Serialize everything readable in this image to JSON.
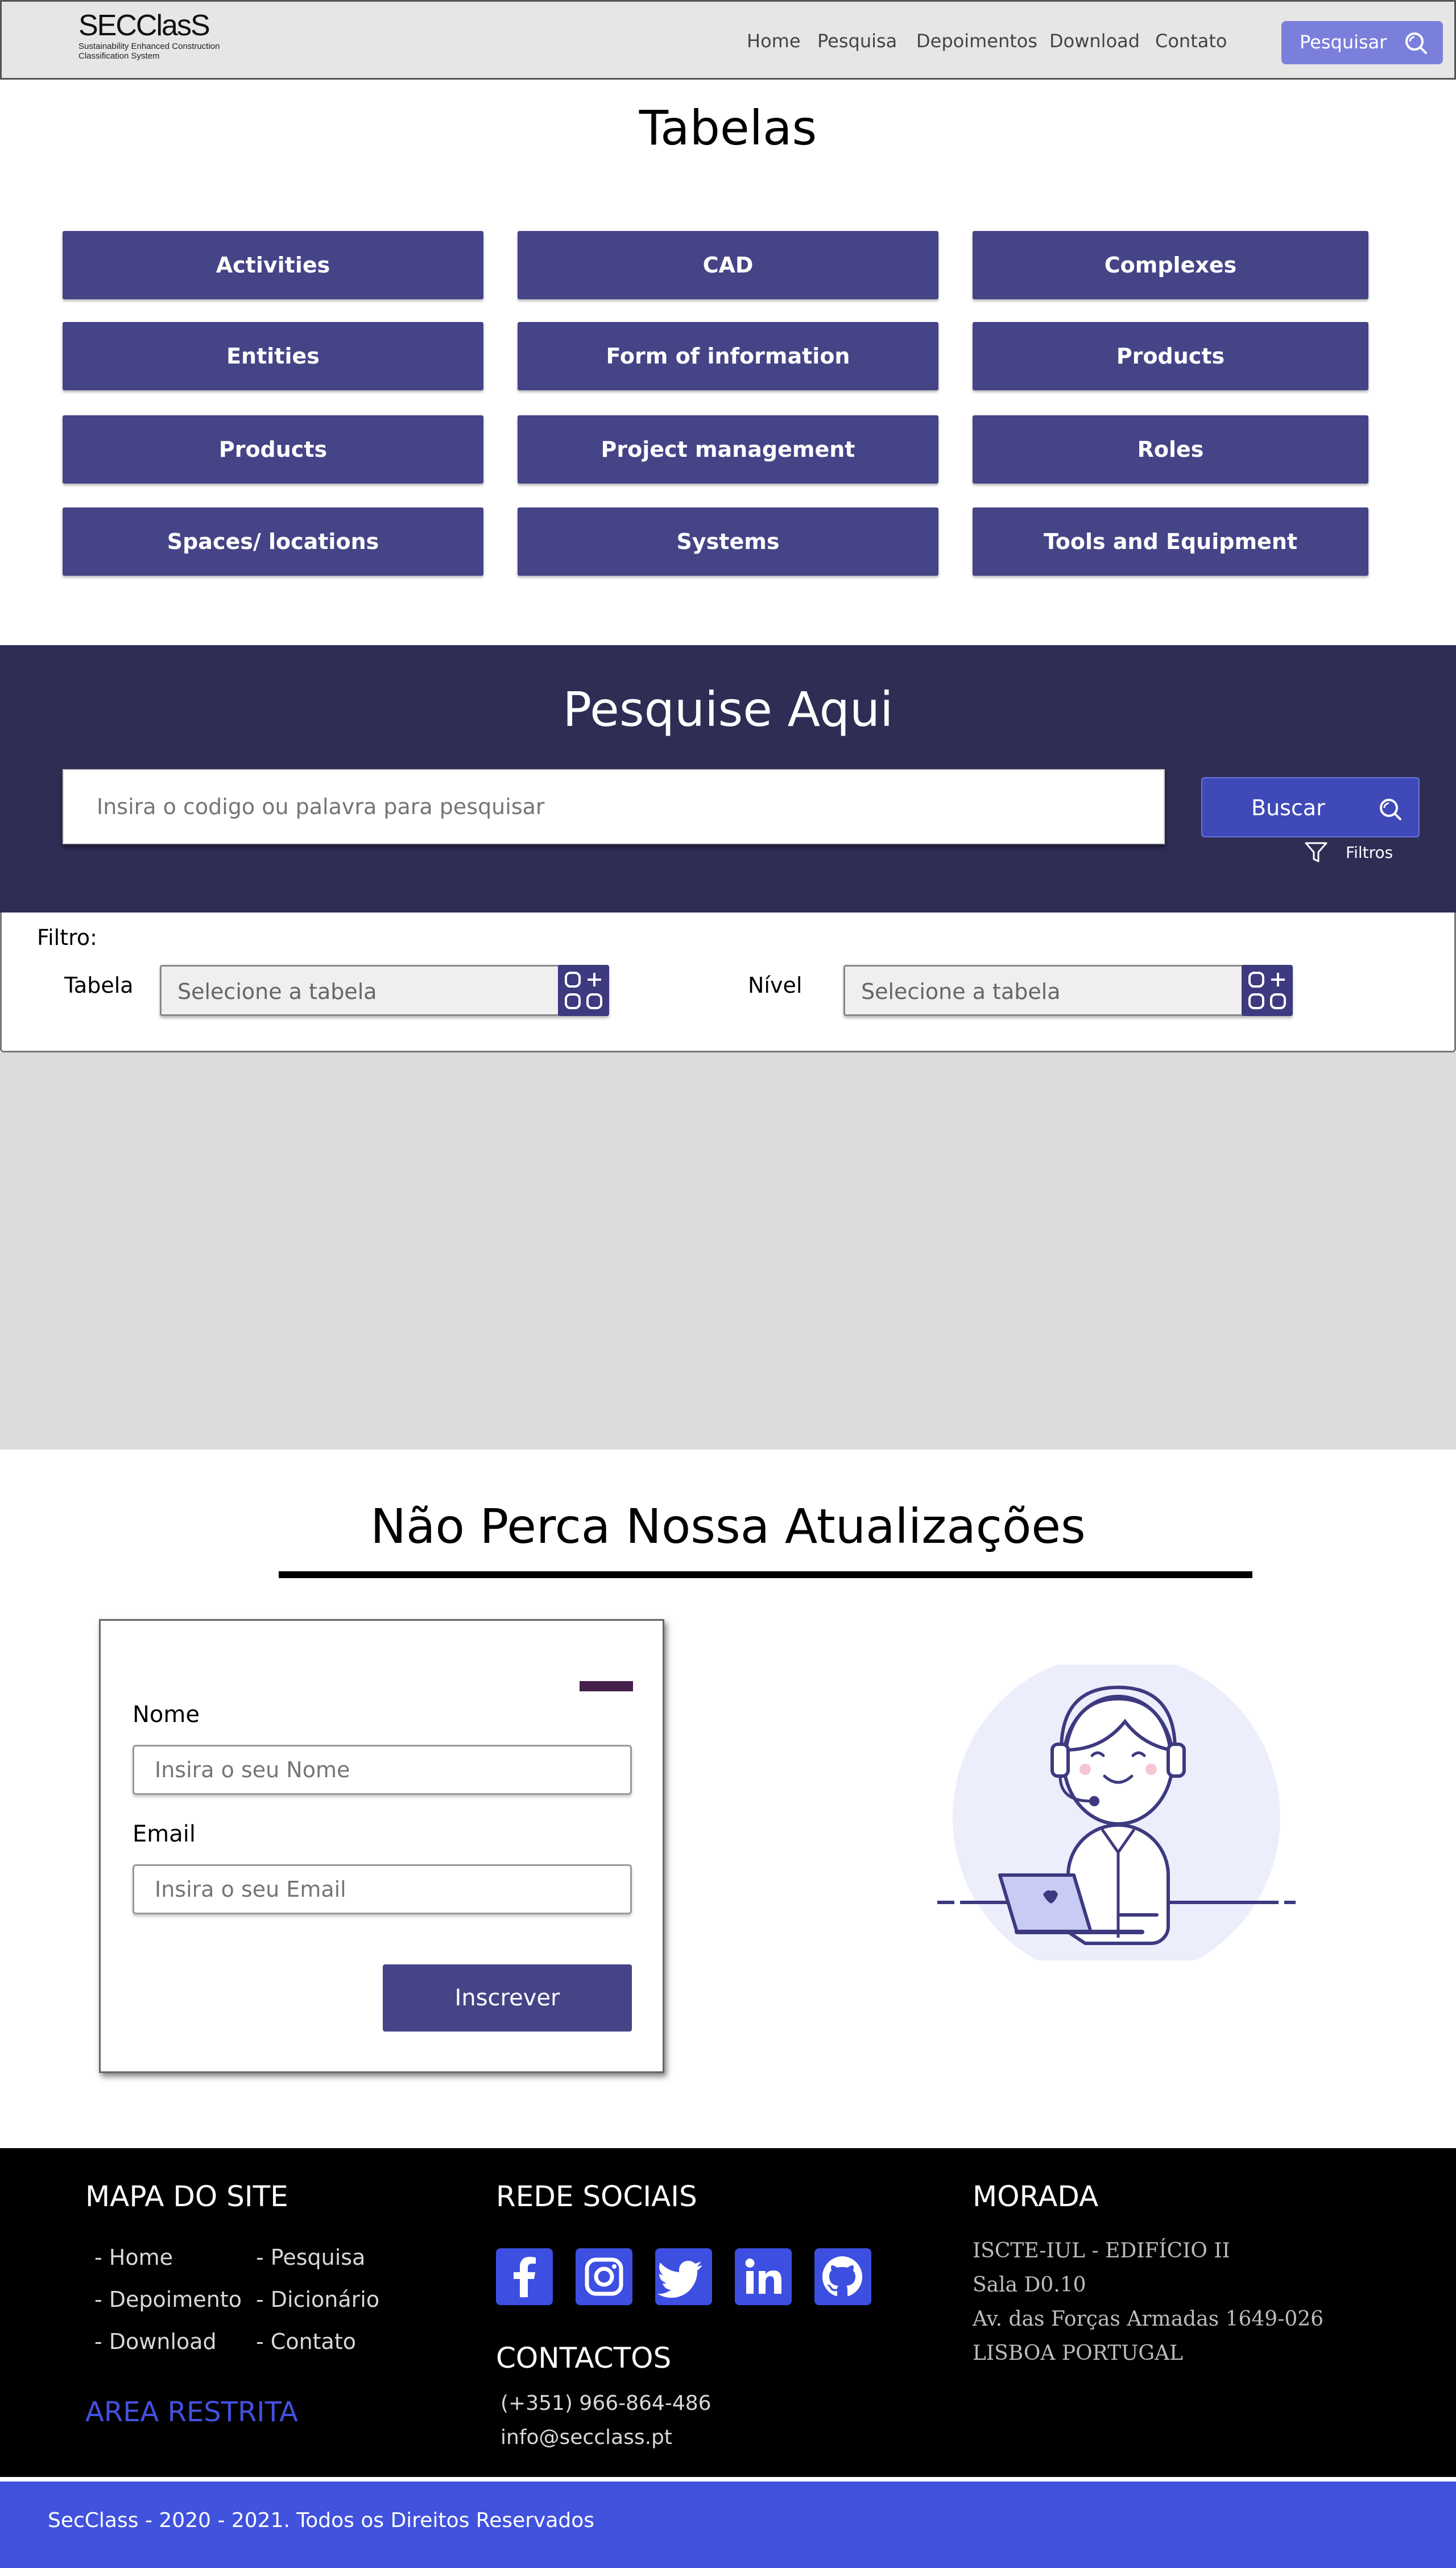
{
  "header": {
    "logo_main": "SECClasS",
    "logo_sub_1": "Sustainability Enhanced Construction",
    "logo_sub_2": "Classification System",
    "nav": [
      "Home",
      "Pesquisa",
      "Depoimentos",
      "Download",
      "Contato"
    ],
    "search_button": "Pesquisar"
  },
  "tabelas": {
    "title": "Tabelas",
    "items": [
      "Activities",
      "CAD",
      "Complexes",
      "Entities",
      "Form of information",
      "Products",
      "Products",
      "Project management",
      "Roles",
      "Spaces/ locations",
      "Systems",
      "Tools and Equipment"
    ]
  },
  "search": {
    "title": "Pesquise Aqui",
    "placeholder": "Insira o codigo ou palavra para pesquisar",
    "button": "Buscar",
    "filters_label": "Filtros"
  },
  "filter": {
    "title": "Filtro:",
    "table_label": "Tabela",
    "table_placeholder": "Selecione a tabela",
    "level_label": "Nível",
    "level_placeholder": "Selecione a tabela"
  },
  "updates": {
    "title": "Não Perca Nossa Atualizações",
    "name_label": "Nome",
    "name_placeholder": "Insira o seu Nome",
    "email_label": "Email",
    "email_placeholder": "Insira o seu Email",
    "submit": "Inscrever"
  },
  "footer": {
    "sitemap_title": "MAPA DO SITE",
    "sitemap_links": [
      "- Home",
      "- Pesquisa",
      "- Depoimento",
      "- Dicionário",
      "- Download",
      "- Contato"
    ],
    "restricted": "AREA RESTRITA",
    "social_title": "REDE SOCIAIS",
    "social_icons": [
      "facebook-icon",
      "instagram-icon",
      "twitter-icon",
      "linkedin-icon",
      "github-icon"
    ],
    "contacts_title": "CONTACTOS",
    "phone": "(+351) 966-864-486",
    "email": "info@secclass.pt",
    "address_title": "MORADA",
    "address_lines": [
      "ISCTE-IUL - EDIFÍCIO II",
      "Sala D0.10",
      "Av. das Forças Armadas 1649-026",
      "LISBOA PORTUGAL"
    ],
    "copyright": "SecClass - 2020 - 2021. Todos os Direitos Reservados"
  },
  "colors": {
    "accent": "#454487",
    "search_band": "#2e2d54",
    "footer_bar": "#4152dd",
    "top_button": "#7b7fdc"
  }
}
